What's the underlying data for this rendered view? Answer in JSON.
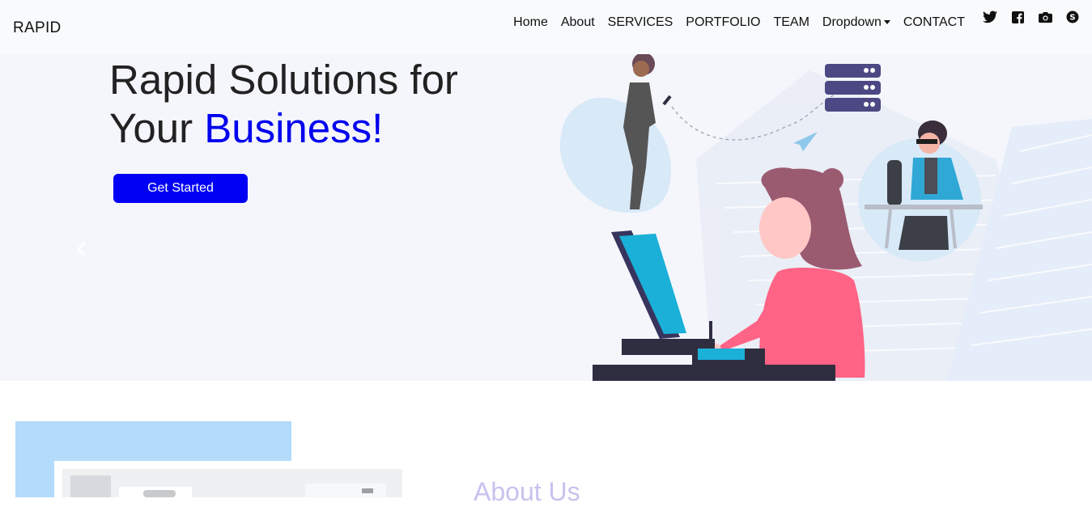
{
  "navbar": {
    "brand": "RAPID",
    "links": [
      {
        "label": "Home"
      },
      {
        "label": "About"
      },
      {
        "label": "SERVICES"
      },
      {
        "label": "PORTFOLIO"
      },
      {
        "label": "TEAM"
      },
      {
        "label": "Dropdown"
      },
      {
        "label": "CONTACT"
      }
    ],
    "socials": [
      "twitter-icon",
      "facebook-icon",
      "instagram-icon",
      "skype-icon"
    ]
  },
  "hero": {
    "title_line1": "Rapid Solutions for",
    "title_line2_prefix": "Your ",
    "title_line2_accent": "Business!",
    "cta_label": "Get Started",
    "accent_color": "#0000ee",
    "button_color": "#0000f5",
    "background_color": "#f4f6fc"
  },
  "about": {
    "heading": "About Us"
  }
}
